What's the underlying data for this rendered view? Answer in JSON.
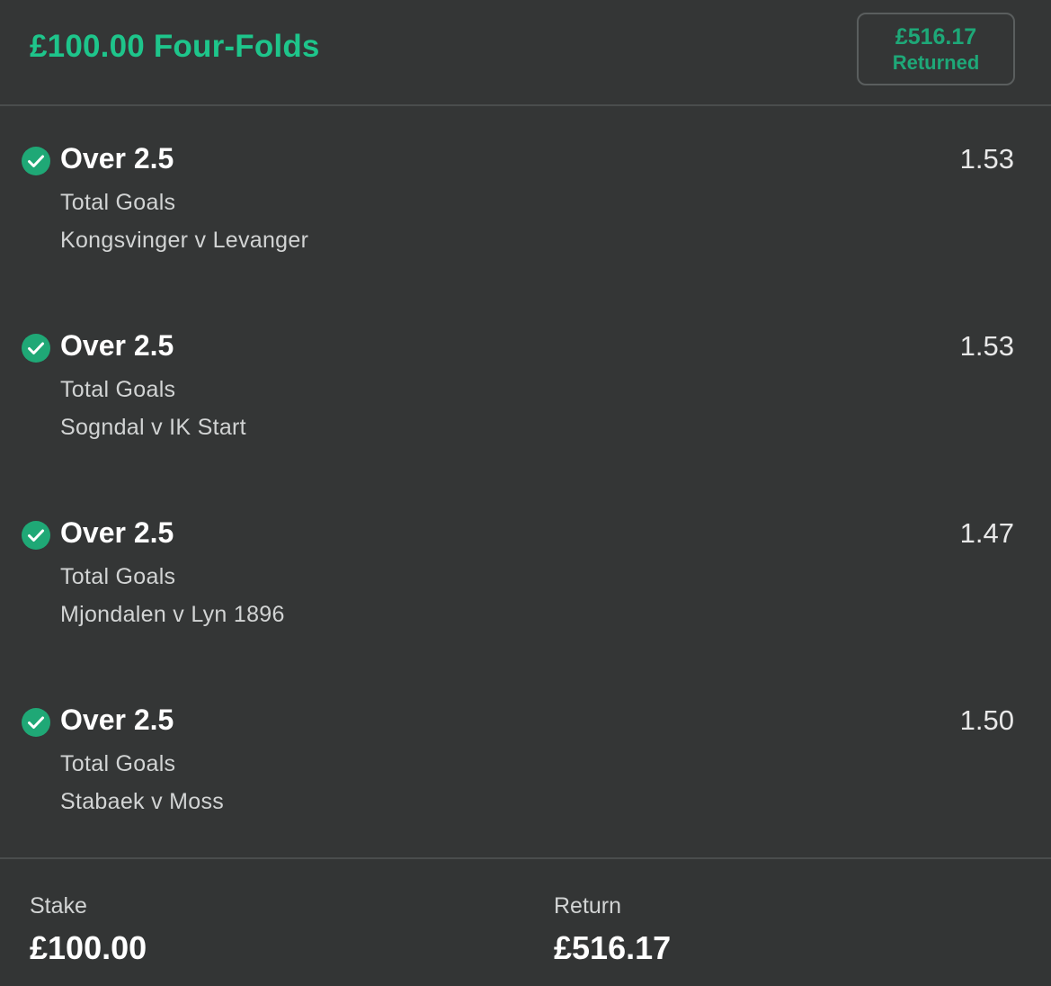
{
  "header": {
    "title": "£100.00 Four-Folds",
    "returned_amount": "£516.17",
    "returned_label": "Returned"
  },
  "selections": [
    {
      "name": "Over 2.5",
      "market": "Total Goals",
      "event": "Kongsvinger v Levanger",
      "odds": "1.53",
      "status_icon": "check-circle-icon"
    },
    {
      "name": "Over 2.5",
      "market": "Total Goals",
      "event": "Sogndal v IK Start",
      "odds": "1.53",
      "status_icon": "check-circle-icon"
    },
    {
      "name": "Over 2.5",
      "market": "Total Goals",
      "event": "Mjondalen v Lyn 1896",
      "odds": "1.47",
      "status_icon": "check-circle-icon"
    },
    {
      "name": "Over 2.5",
      "market": "Total Goals",
      "event": "Stabaek v Moss",
      "odds": "1.50",
      "status_icon": "check-circle-icon"
    }
  ],
  "footer": {
    "stake_label": "Stake",
    "stake_value": "£100.00",
    "return_label": "Return",
    "return_value": "£516.17"
  },
  "colors": {
    "background": "#343636",
    "accent_green": "#1ec58b",
    "check_green": "#1fa876",
    "divider": "#4a4d4d"
  }
}
